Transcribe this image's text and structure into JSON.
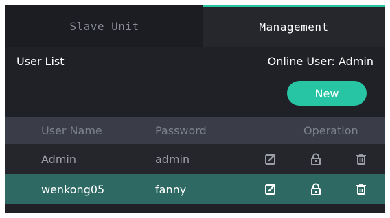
{
  "tabs": [
    {
      "label": "Slave Unit",
      "active": false
    },
    {
      "label": "Management",
      "active": true
    }
  ],
  "user_list_title": "User List",
  "online_user": "Online User: Admin",
  "new_button_label": "New",
  "table": {
    "headers": {
      "user_name": "User Name",
      "password": "Password",
      "operation": "Operation"
    },
    "rows": [
      {
        "user_name": "Admin",
        "password": "admin",
        "icons": [
          "edit-icon",
          "lock-icon",
          "trash-icon"
        ]
      },
      {
        "user_name": "wenkong05",
        "password": "fanny",
        "icons": [
          "edit-icon",
          "lock-icon",
          "trash-icon"
        ]
      }
    ]
  },
  "colors": {
    "accent": "#27c5a3",
    "panel_bg": "#1f2126",
    "header_bg": "#3a3d47",
    "selected_row_bg": "#2e6a63"
  }
}
